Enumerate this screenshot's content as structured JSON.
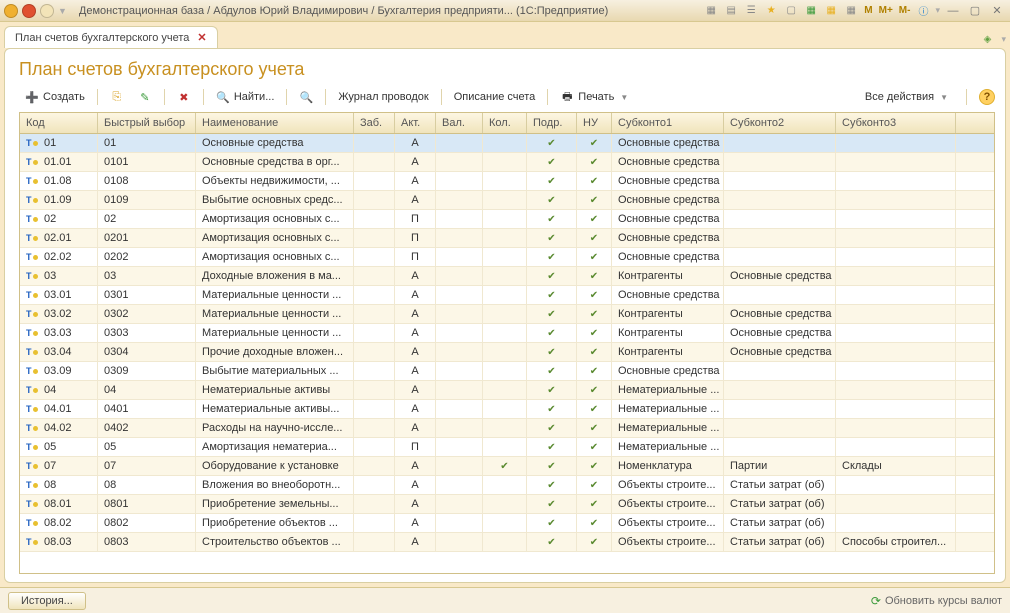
{
  "titlebar": {
    "title": "Демонстрационная база / Абдулов Юрий Владимирович / Бухгалтерия предприяти...   (1С:Предприятие)",
    "m": "M",
    "m_plus": "M+",
    "m_minus": "M-"
  },
  "tab": {
    "label": "План счетов бухгалтерского учета"
  },
  "page": {
    "title": "План счетов бухгалтерского учета"
  },
  "toolbar": {
    "create": "Создать",
    "find": "Найти...",
    "journal": "Журнал проводок",
    "description": "Описание счета",
    "print": "Печать",
    "all_actions": "Все действия"
  },
  "columns": [
    "Код",
    "Быстрый выбор",
    "Наименование",
    "Заб.",
    "Акт.",
    "Вал.",
    "Кол.",
    "Подр.",
    "НУ",
    "Субконто1",
    "Субконто2",
    "Субконто3"
  ],
  "rows": [
    {
      "code": "01",
      "quick": "01",
      "name": "Основные средства",
      "act": "А",
      "val": "",
      "qty": "",
      "podr": "✓",
      "nu": "✓",
      "s1": "Основные средства",
      "s2": "",
      "s3": "",
      "selected": true
    },
    {
      "code": "01.01",
      "quick": "0101",
      "name": "Основные средства в орг...",
      "act": "А",
      "val": "",
      "qty": "",
      "podr": "✓",
      "nu": "✓",
      "s1": "Основные средства",
      "s2": "",
      "s3": ""
    },
    {
      "code": "01.08",
      "quick": "0108",
      "name": "Объекты недвижимости, ...",
      "act": "А",
      "val": "",
      "qty": "",
      "podr": "✓",
      "nu": "✓",
      "s1": "Основные средства",
      "s2": "",
      "s3": ""
    },
    {
      "code": "01.09",
      "quick": "0109",
      "name": "Выбытие основных средс...",
      "act": "А",
      "val": "",
      "qty": "",
      "podr": "✓",
      "nu": "✓",
      "s1": "Основные средства",
      "s2": "",
      "s3": ""
    },
    {
      "code": "02",
      "quick": "02",
      "name": "Амортизация основных с...",
      "act": "П",
      "val": "",
      "qty": "",
      "podr": "✓",
      "nu": "✓",
      "s1": "Основные средства",
      "s2": "",
      "s3": ""
    },
    {
      "code": "02.01",
      "quick": "0201",
      "name": "Амортизация основных с...",
      "act": "П",
      "val": "",
      "qty": "",
      "podr": "✓",
      "nu": "✓",
      "s1": "Основные средства",
      "s2": "",
      "s3": ""
    },
    {
      "code": "02.02",
      "quick": "0202",
      "name": "Амортизация основных с...",
      "act": "П",
      "val": "",
      "qty": "",
      "podr": "✓",
      "nu": "✓",
      "s1": "Основные средства",
      "s2": "",
      "s3": ""
    },
    {
      "code": "03",
      "quick": "03",
      "name": "Доходные вложения в ма...",
      "act": "А",
      "val": "",
      "qty": "",
      "podr": "✓",
      "nu": "✓",
      "s1": "Контрагенты",
      "s2": "Основные средства",
      "s3": ""
    },
    {
      "code": "03.01",
      "quick": "0301",
      "name": "Материальные ценности ...",
      "act": "А",
      "val": "",
      "qty": "",
      "podr": "✓",
      "nu": "✓",
      "s1": "Основные средства",
      "s2": "",
      "s3": ""
    },
    {
      "code": "03.02",
      "quick": "0302",
      "name": "Материальные ценности ...",
      "act": "А",
      "val": "",
      "qty": "",
      "podr": "✓",
      "nu": "✓",
      "s1": "Контрагенты",
      "s2": "Основные средства",
      "s3": ""
    },
    {
      "code": "03.03",
      "quick": "0303",
      "name": "Материальные ценности ...",
      "act": "А",
      "val": "",
      "qty": "",
      "podr": "✓",
      "nu": "✓",
      "s1": "Контрагенты",
      "s2": "Основные средства",
      "s3": ""
    },
    {
      "code": "03.04",
      "quick": "0304",
      "name": "Прочие доходные вложен...",
      "act": "А",
      "val": "",
      "qty": "",
      "podr": "✓",
      "nu": "✓",
      "s1": "Контрагенты",
      "s2": "Основные средства",
      "s3": ""
    },
    {
      "code": "03.09",
      "quick": "0309",
      "name": "Выбытие материальных ...",
      "act": "А",
      "val": "",
      "qty": "",
      "podr": "✓",
      "nu": "✓",
      "s1": "Основные средства",
      "s2": "",
      "s3": ""
    },
    {
      "code": "04",
      "quick": "04",
      "name": "Нематериальные активы",
      "act": "А",
      "val": "",
      "qty": "",
      "podr": "✓",
      "nu": "✓",
      "s1": "Нематериальные ...",
      "s2": "",
      "s3": ""
    },
    {
      "code": "04.01",
      "quick": "0401",
      "name": "Нематериальные активы...",
      "act": "А",
      "val": "",
      "qty": "",
      "podr": "✓",
      "nu": "✓",
      "s1": "Нематериальные ...",
      "s2": "",
      "s3": ""
    },
    {
      "code": "04.02",
      "quick": "0402",
      "name": "Расходы на научно-иссле...",
      "act": "А",
      "val": "",
      "qty": "",
      "podr": "✓",
      "nu": "✓",
      "s1": "Нематериальные ...",
      "s2": "",
      "s3": ""
    },
    {
      "code": "05",
      "quick": "05",
      "name": "Амортизация нематериа...",
      "act": "П",
      "val": "",
      "qty": "",
      "podr": "✓",
      "nu": "✓",
      "s1": "Нематериальные ...",
      "s2": "",
      "s3": ""
    },
    {
      "code": "07",
      "quick": "07",
      "name": "Оборудование к установке",
      "act": "А",
      "val": "",
      "qty": "✓",
      "podr": "✓",
      "nu": "✓",
      "s1": "Номенклатура",
      "s2": "Партии",
      "s3": "Склады"
    },
    {
      "code": "08",
      "quick": "08",
      "name": "Вложения во внеоборотн...",
      "act": "А",
      "val": "",
      "qty": "",
      "podr": "✓",
      "nu": "✓",
      "s1": "Объекты строите...",
      "s2": "Статьи затрат (об)",
      "s3": ""
    },
    {
      "code": "08.01",
      "quick": "0801",
      "name": "Приобретение земельны...",
      "act": "А",
      "val": "",
      "qty": "",
      "podr": "✓",
      "nu": "✓",
      "s1": "Объекты строите...",
      "s2": "Статьи затрат (об)",
      "s3": ""
    },
    {
      "code": "08.02",
      "quick": "0802",
      "name": "Приобретение объектов ...",
      "act": "А",
      "val": "",
      "qty": "",
      "podr": "✓",
      "nu": "✓",
      "s1": "Объекты строите...",
      "s2": "Статьи затрат (об)",
      "s3": ""
    },
    {
      "code": "08.03",
      "quick": "0803",
      "name": "Строительство объектов ...",
      "act": "А",
      "val": "",
      "qty": "",
      "podr": "✓",
      "nu": "✓",
      "s1": "Объекты строите...",
      "s2": "Статьи затрат (об)",
      "s3": "Способы строител..."
    }
  ],
  "status": {
    "history": "История...",
    "refresh": "Обновить курсы валют"
  }
}
